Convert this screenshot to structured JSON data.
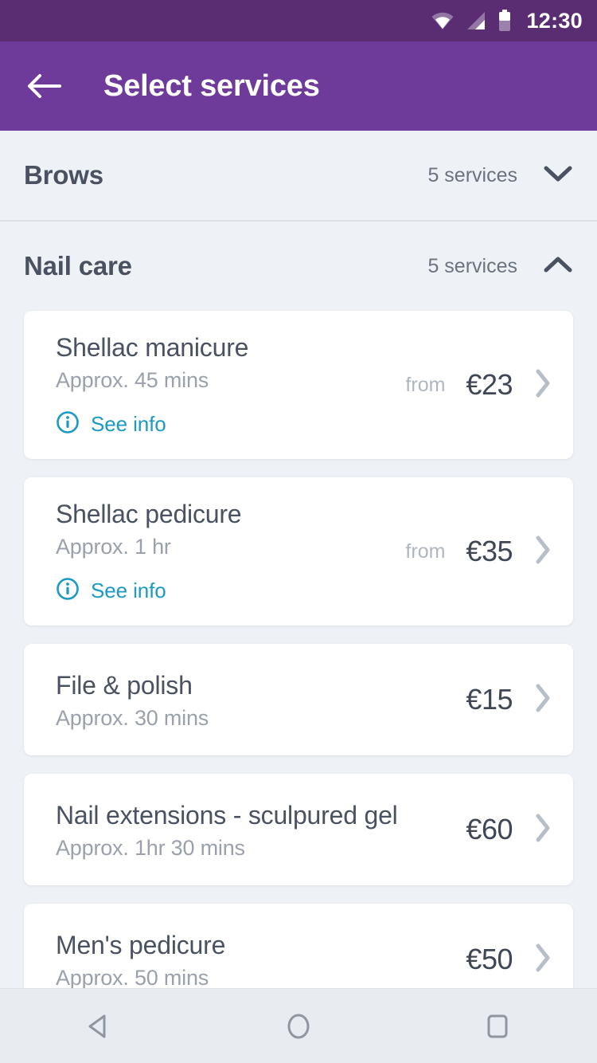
{
  "status_bar": {
    "time": "12:30",
    "icons": [
      "wifi-icon",
      "signal-icon",
      "battery-icon"
    ]
  },
  "app_bar": {
    "back_icon": "back-arrow-icon",
    "title": "Select services",
    "background_color": "#6f3b9a"
  },
  "colors": {
    "status_bar": "#5a2d73",
    "app_bar": "#6f3b9a",
    "page_background": "#eef1f5",
    "card_background": "#ffffff",
    "accent_link": "#1a9ac4",
    "text_primary": "#4a5160",
    "text_muted": "#9aa1ac",
    "chevron": "#b8bec8"
  },
  "sections": [
    {
      "title": "Brows",
      "count_label": "5 services",
      "expanded": false,
      "toggle_icon": "chevron-down-icon",
      "services": []
    },
    {
      "title": "Nail care",
      "count_label": "5 services",
      "expanded": true,
      "toggle_icon": "chevron-up-icon",
      "services": [
        {
          "name": "Shellac manicure",
          "duration": "Approx. 45 mins",
          "price_prefix": "from",
          "price": "€23",
          "info_link": "See info",
          "info_icon": "info-circle-icon",
          "chevron_icon": "chevron-right-icon"
        },
        {
          "name": "Shellac pedicure",
          "duration": "Approx. 1 hr",
          "price_prefix": "from",
          "price": "€35",
          "info_link": "See info",
          "info_icon": "info-circle-icon",
          "chevron_icon": "chevron-right-icon"
        },
        {
          "name": "File & polish",
          "duration": "Approx. 30 mins",
          "price_prefix": "",
          "price": "€15",
          "info_link": "",
          "info_icon": "",
          "chevron_icon": "chevron-right-icon"
        },
        {
          "name": "Nail extensions - sculpured gel",
          "duration": "Approx. 1hr 30 mins",
          "price_prefix": "",
          "price": "€60",
          "info_link": "",
          "info_icon": "",
          "chevron_icon": "chevron-right-icon"
        },
        {
          "name": "Men's pedicure",
          "duration": "Approx. 50 mins",
          "price_prefix": "",
          "price": "€50",
          "info_link": "",
          "info_icon": "",
          "chevron_icon": "chevron-right-icon"
        }
      ]
    }
  ],
  "nav_bar": {
    "back_icon": "triangle-back-icon",
    "home_icon": "circle-home-icon",
    "recents_icon": "square-recents-icon"
  }
}
